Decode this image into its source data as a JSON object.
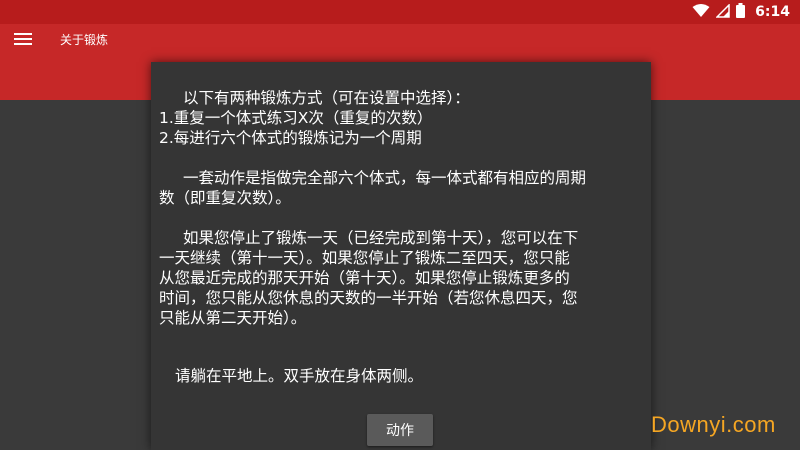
{
  "status_bar": {
    "time": "6:14",
    "icons": [
      "wifi-icon",
      "signal-icon",
      "battery-icon"
    ]
  },
  "app_bar": {
    "menu_icon": "hamburger-menu-icon",
    "title": "关于锻炼"
  },
  "dialog": {
    "lines": [
      "以下有两种锻炼方式（可在设置中选择）：",
      "1.重复一个体式练习X次（重复的次数）",
      "2.每进行六个体式的锻炼记为一个周期",
      "",
      "一套动作是指做完全部六个体式，每一体式都有相应的周期",
      "数（即重复次数）。",
      "",
      "如果您停止了锻炼一天（已经完成到第十天），您可以在下",
      "一天继续（第十一天）。如果您停止了锻炼二至四天，您只能",
      "从您最近完成的那天开始（第十天）。如果您停止锻炼更多的",
      "时间，您只能从您休息的天数的一半开始（若您休息四天，您",
      "只能从第二天开始）。",
      "",
      "",
      "请躺在平地上。双手放在身体两侧。"
    ],
    "action_button_label": "动作"
  },
  "watermark": "Downyi.com",
  "colors": {
    "status_bar": "#b71c1c",
    "app_bar": "#c62828",
    "dialog_bg": "#353535",
    "button_bg": "#5a5a5a",
    "watermark": "#f5a623"
  }
}
